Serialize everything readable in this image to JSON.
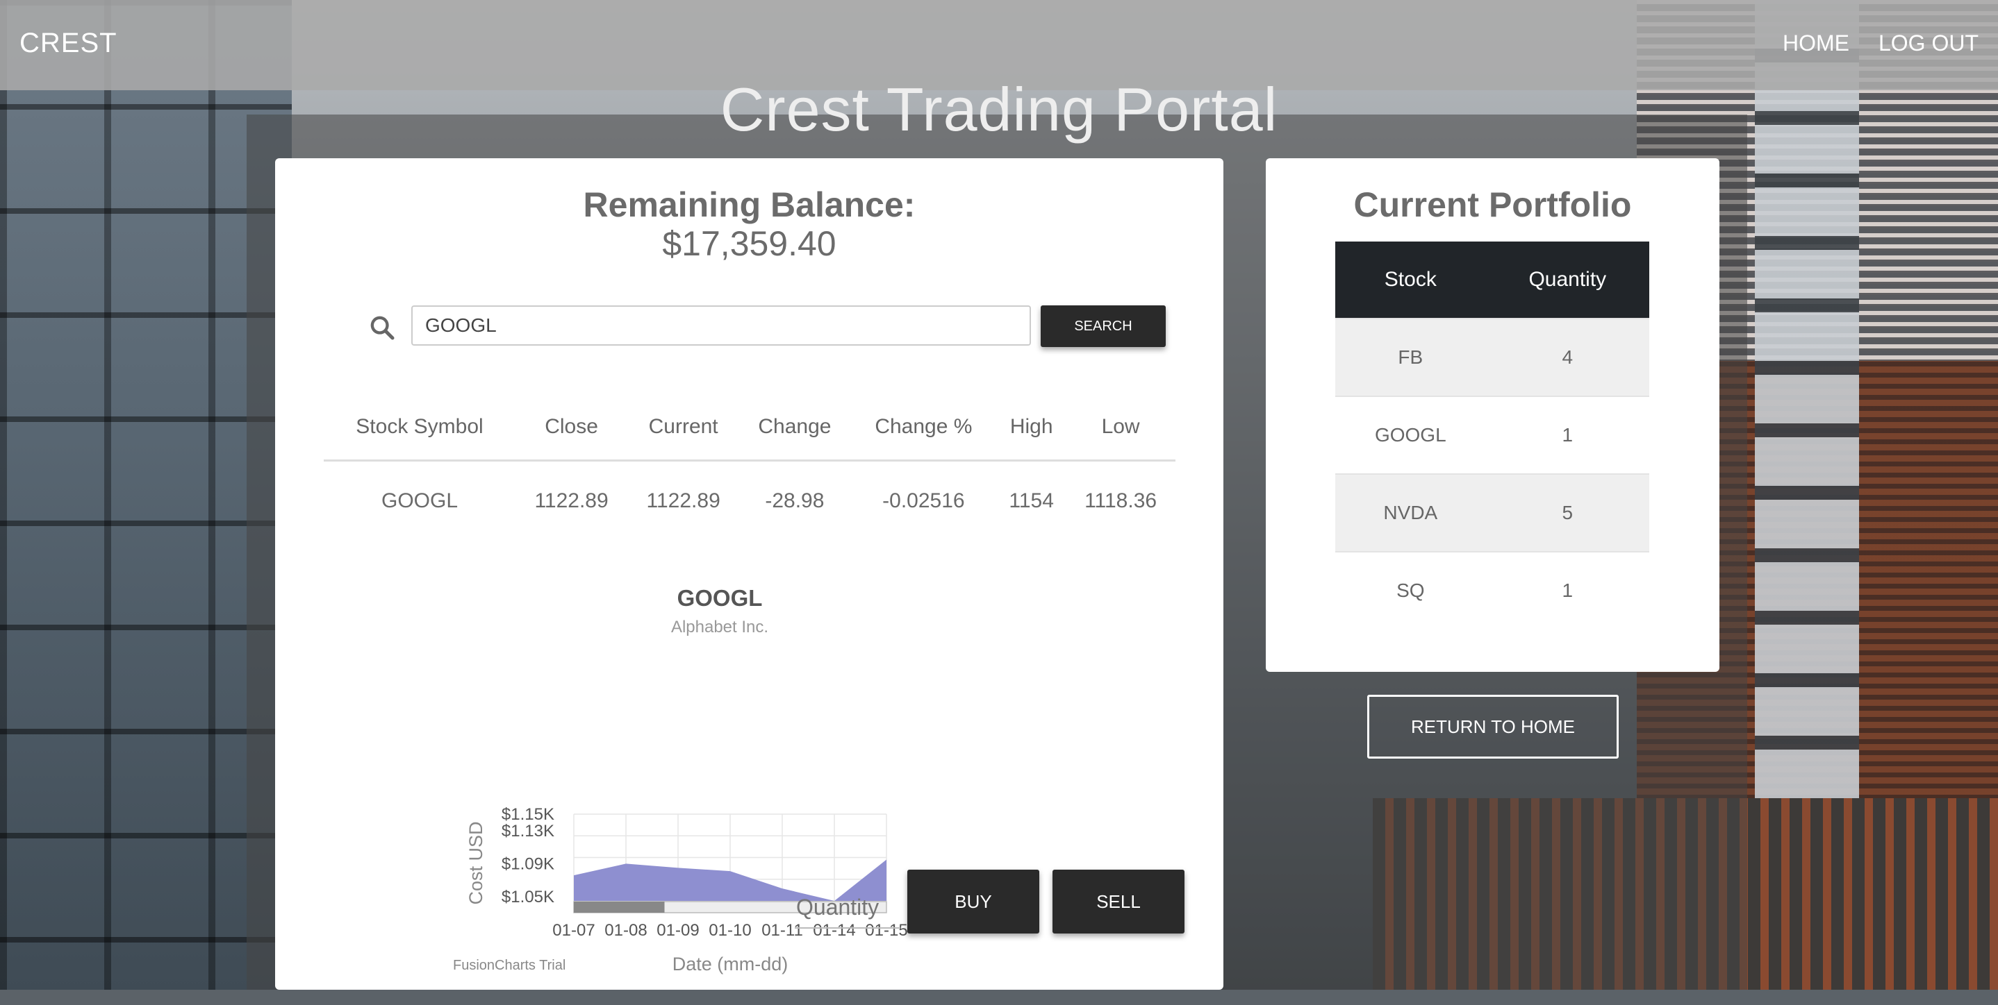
{
  "navbar": {
    "brand": "CREST",
    "links": [
      "HOME",
      "LOG OUT"
    ]
  },
  "page_title": "Crest Trading Portal",
  "balance": {
    "title": "Remaining Balance:",
    "value": "$17,359.40"
  },
  "search": {
    "value": "GOOGL",
    "button_label": "SEARCH",
    "icon": "search-icon"
  },
  "stock_table": {
    "headers": [
      "Stock Symbol",
      "Close",
      "Current",
      "Change",
      "Change %",
      "High",
      "Low"
    ],
    "row": [
      "GOOGL",
      "1122.89",
      "1122.89",
      "-28.98",
      "-0.02516",
      "1154",
      "1118.36"
    ]
  },
  "chart_data": {
    "type": "area",
    "title": "GOOGL",
    "subtitle": "Alphabet Inc.",
    "xlabel": "Date (mm-dd)",
    "ylabel": "Cost USD",
    "categories": [
      "01-07",
      "01-08",
      "01-09",
      "01-10",
      "01-11",
      "01-14",
      "01-15"
    ],
    "values": [
      1076,
      1090,
      1085,
      1081,
      1060,
      1045,
      1095
    ],
    "yticks": [
      "$1.15K",
      "$1.13K",
      "$1.09K",
      "$1.05K"
    ],
    "ylim": [
      1045,
      1150
    ],
    "grid": true,
    "colors": {
      "fill": "#8e8fd0",
      "scroll": "#888888"
    },
    "watermark": "FusionCharts Trial"
  },
  "trade": {
    "quantity_placeholder": "Quantity",
    "buy_label": "BUY",
    "sell_label": "SELL"
  },
  "portfolio": {
    "title": "Current Portfolio",
    "headers": [
      "Stock",
      "Quantity"
    ],
    "rows": [
      {
        "stock": "FB",
        "quantity": "4"
      },
      {
        "stock": "GOOGL",
        "quantity": "1"
      },
      {
        "stock": "NVDA",
        "quantity": "5"
      },
      {
        "stock": "SQ",
        "quantity": "1"
      }
    ]
  },
  "return_button": "RETURN TO HOME"
}
